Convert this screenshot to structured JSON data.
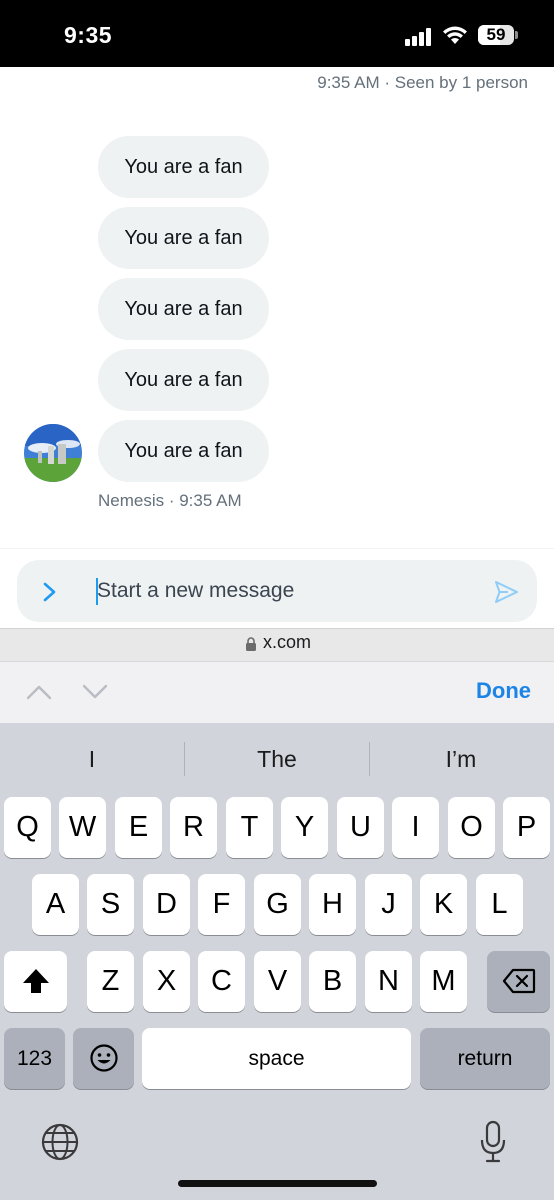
{
  "status_bar": {
    "time": "9:35",
    "battery": "59"
  },
  "conversation": {
    "seen_meta": "9:35 AM · Seen by 1 person",
    "messages": [
      {
        "text": "You are a fan"
      },
      {
        "text": "You are a fan"
      },
      {
        "text": "You are a fan"
      },
      {
        "text": "You are a fan"
      },
      {
        "text": "You are a fan"
      }
    ],
    "sender_meta": "Nemesis · 9:35 AM"
  },
  "composer": {
    "placeholder": "Start a new message",
    "value": ""
  },
  "browser": {
    "url": "x.com"
  },
  "form_toolbar": {
    "done_label": "Done"
  },
  "keyboard": {
    "suggestions": [
      "I",
      "The",
      "I’m"
    ],
    "row1": [
      "Q",
      "W",
      "E",
      "R",
      "T",
      "Y",
      "U",
      "I",
      "O",
      "P"
    ],
    "row2": [
      "A",
      "S",
      "D",
      "F",
      "G",
      "H",
      "J",
      "K",
      "L"
    ],
    "row3": [
      "Z",
      "X",
      "C",
      "V",
      "B",
      "N",
      "M"
    ],
    "numbers_label": "123",
    "space_label": "space",
    "return_label": "return"
  },
  "icons": {
    "expand": "chevron-right-icon",
    "send": "send-icon",
    "lock": "lock-icon",
    "shift": "shift-icon",
    "delete": "backspace-icon",
    "emoji": "emoji-icon",
    "globe": "globe-icon",
    "mic": "microphone-icon"
  },
  "colors": {
    "accent": "#1d9bf0",
    "done": "#1b84e6",
    "bubble": "#eef2f3",
    "keyboard_bg": "#d1d4da"
  }
}
